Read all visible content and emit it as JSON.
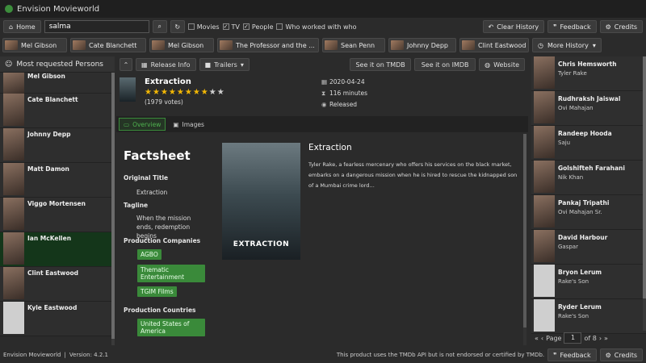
{
  "app": {
    "title": "Envision Movieworld"
  },
  "toolbar": {
    "home_label": "Home",
    "search_value": "salma",
    "filters": [
      {
        "label": "Movies",
        "checked": false
      },
      {
        "label": "TV",
        "checked": true
      },
      {
        "label": "People",
        "checked": true
      },
      {
        "label": "Who worked with who",
        "checked": false
      }
    ],
    "clear_history_label": "Clear History",
    "feedback_label": "Feedback",
    "credits_label": "Credits"
  },
  "history": {
    "items": [
      "Mel Gibson",
      "Cate Blanchett",
      "Mel Gibson",
      "The Professor and the ...",
      "Sean Penn",
      "Johnny Depp",
      "Clint Eastwood"
    ],
    "more_label": "More History"
  },
  "left_panel": {
    "header": "Most requested Persons",
    "persons": [
      "Mel Gibson",
      "Cate Blanchett",
      "Johnny Depp",
      "Matt Damon",
      "Viggo Mortensen",
      "Ian McKellen",
      "Clint Eastwood",
      "Kyle Eastwood"
    ],
    "selected": "Ian McKellen"
  },
  "movie": {
    "tabs": {
      "release_info": "Release Info",
      "trailers": "Trailers",
      "tmdb": "See it on TMDB",
      "imdb": "See it on IMDB",
      "website": "Website"
    },
    "title": "Extraction",
    "rating_stars": 7.5,
    "votes": "(1979 votes)",
    "release_date": "2020-04-24",
    "runtime": "116 minutes",
    "status": "Released",
    "subtabs": {
      "overview": "Overview",
      "images": "Images"
    },
    "factsheet": {
      "heading": "Factsheet",
      "original_title_label": "Original Title",
      "original_title": "Extraction",
      "tagline_label": "Tagline",
      "tagline": "When the mission ends, redemption begins",
      "companies_label": "Production Companies",
      "companies": [
        "AGBO",
        "Thematic Entertainment",
        "TGIM Films"
      ],
      "countries_label": "Production Countries",
      "countries": [
        "United States of America"
      ]
    },
    "poster_title": "EXTRACTION",
    "overview_title": "Extraction",
    "overview_text": "Tyler Rake, a fearless mercenary who offers his services on the black market, embarks on a dangerous mission when he is hired to rescue the kidnapped son of a Mumbai crime lord…"
  },
  "cast": {
    "items": [
      {
        "name": "Chris Hemsworth",
        "role": "Tyler Rake",
        "photo": true
      },
      {
        "name": "Rudhraksh Jaiswal",
        "role": "Ovi Mahajan",
        "photo": true
      },
      {
        "name": "Randeep Hooda",
        "role": "Saju",
        "photo": true
      },
      {
        "name": "Golshifteh Farahani",
        "role": "Nik Khan",
        "photo": true
      },
      {
        "name": "Pankaj Tripathi",
        "role": "Ovi Mahajan Sr.",
        "photo": true
      },
      {
        "name": "David Harbour",
        "role": "Gaspar",
        "photo": true
      },
      {
        "name": "Bryon Lerum",
        "role": "Rake's Son",
        "photo": false
      },
      {
        "name": "Ryder Lerum",
        "role": "Rake's Son",
        "photo": false
      }
    ],
    "pager": {
      "page_label": "Page",
      "page": "1",
      "of_label": "of 8"
    }
  },
  "statusbar": {
    "app_name": "Envision Movieworld",
    "version": "Version: 4.2.1",
    "disclaimer": "This product uses the TMDb API but is not endorsed or certified by TMDb.",
    "feedback_label": "Feedback",
    "credits_label": "Credits"
  },
  "colors": {
    "accent_green": "#3a8a3a",
    "selected_row": "#14361a",
    "star": "#f2b705"
  }
}
